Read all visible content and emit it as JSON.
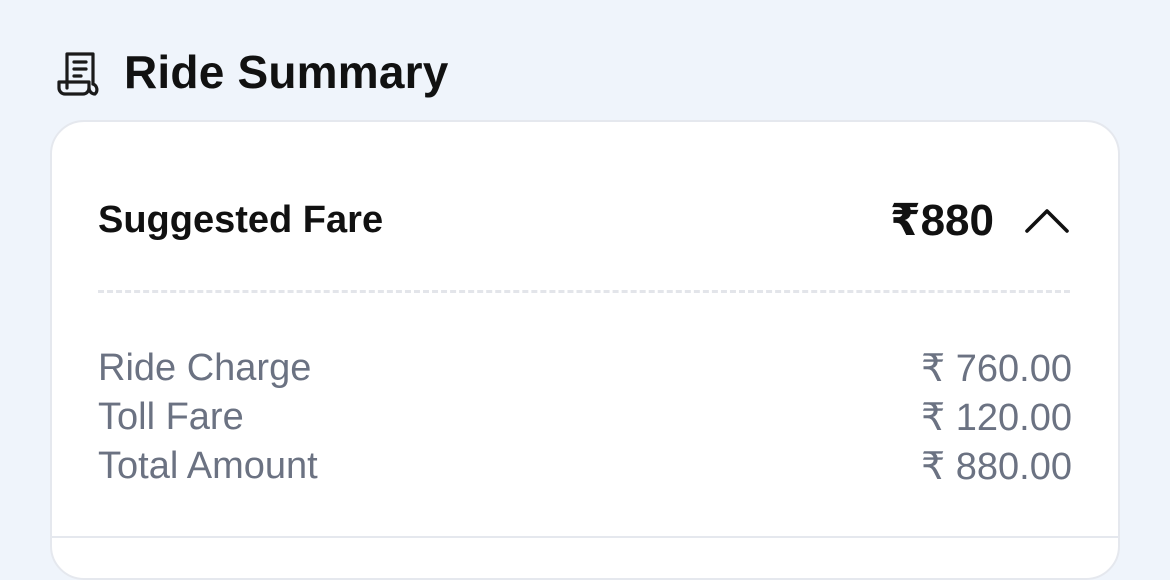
{
  "header": {
    "icon": "receipt-icon",
    "title": "Ride Summary"
  },
  "fare": {
    "label": "Suggested Fare",
    "value": "₹880",
    "toggle_icon": "chevron-up-icon"
  },
  "breakdown": [
    {
      "label": "Ride Charge",
      "value": "₹ 760.00"
    },
    {
      "label": "Toll Fare",
      "value": "₹ 120.00"
    },
    {
      "label": "Total Amount",
      "value": "₹ 880.00"
    }
  ],
  "colors": {
    "background": "#eff4fb",
    "card": "#ffffff",
    "primary_text": "#111111",
    "secondary_text": "#6b7282",
    "divider": "#e3e5ea"
  }
}
